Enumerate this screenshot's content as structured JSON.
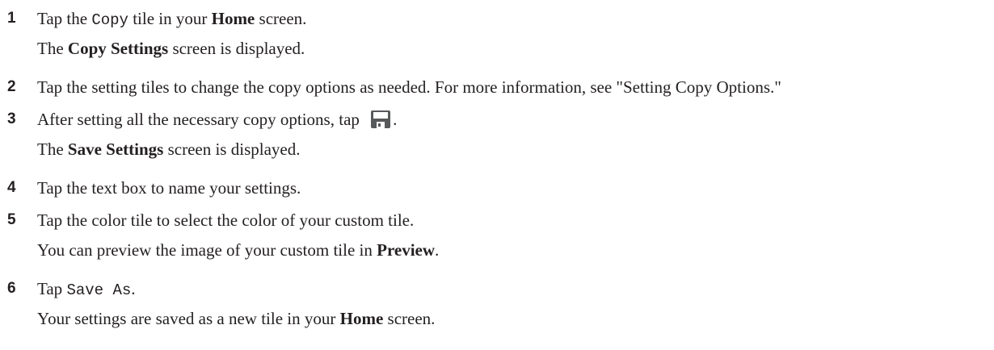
{
  "steps": [
    {
      "number": "1",
      "text_a": "Tap the ",
      "code": "Copy",
      "text_b": " tile in your ",
      "bold": "Home",
      "text_c": " screen.",
      "result_a": "The ",
      "result_bold": "Copy Settings",
      "result_b": " screen is displayed."
    },
    {
      "number": "2",
      "text": "Tap the setting tiles to change the copy options as needed. For more information, see \"Setting Copy Options.\""
    },
    {
      "number": "3",
      "text_a": "After setting all the necessary copy options, tap ",
      "icon": "save-icon",
      "text_b": ".",
      "result_a": "The ",
      "result_bold": "Save Settings",
      "result_b": " screen is displayed."
    },
    {
      "number": "4",
      "text": "Tap the text box to name your settings."
    },
    {
      "number": "5",
      "text": "Tap the color tile to select the color of your custom tile.",
      "result_a": "You can preview the image of your custom tile in ",
      "result_bold": "Preview",
      "result_b": "."
    },
    {
      "number": "6",
      "text_a": "Tap ",
      "code": "Save As",
      "text_b": ".",
      "result_a": "Your settings are saved as a new tile in your ",
      "result_bold": "Home",
      "result_b": " screen."
    }
  ],
  "colors": {
    "text": "#231f20",
    "icon_fill": "#58595b"
  }
}
